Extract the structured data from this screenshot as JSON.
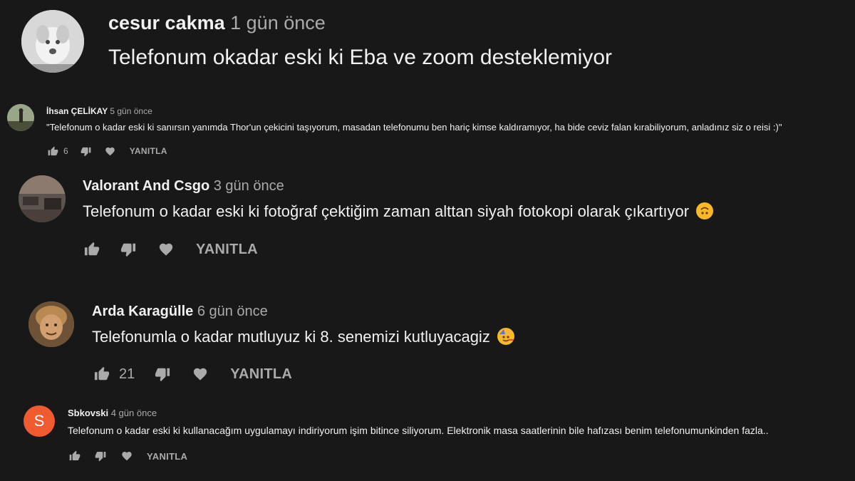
{
  "comments": [
    {
      "author": "cesur cakma",
      "time": "1 gün önce",
      "text": "Telefonum okadar eski ki Eba ve zoom desteklemiyor"
    },
    {
      "author": "İhsan ÇELİKAY",
      "time": "5 gün önce",
      "text": "\"Telefonum o kadar eski ki sanırsın yanımda Thor'un çekicini taşıyorum, masadan telefonumu ben hariç kimse kaldıramıyor, ha bide ceviz falan kırabiliyorum, anladınız siz o reisi :)\"",
      "likes": "6",
      "reply_label": "YANITLA"
    },
    {
      "author": "Valorant And Csgo",
      "time": "3 gün önce",
      "text": "Telefonum o kadar eski ki fotoğraf çektiğim zaman alttan siyah fotokopi olarak çıkartıyor",
      "emoji": "upside-down-face",
      "reply_label": "YANITLA"
    },
    {
      "author": "Arda Karagülle",
      "time": "6 gün önce",
      "text": "Telefonumla o kadar mutluyuz ki 8. senemizi kutluyacagiz",
      "emoji": "partying-face",
      "likes": "21",
      "reply_label": "YANITLA"
    },
    {
      "author": "Sbkovski",
      "time": "4 gün önce",
      "avatar_letter": "S",
      "avatar_color": "#ef5b2f",
      "text": "Telefonum o kadar eski ki kullanacağım uygulamayı indiriyorum işim bitince siliyorum. Elektronik masa saatlerinin bile hafızası benim telefonumunkinden fazla..",
      "reply_label": "YANITLA"
    }
  ],
  "colors": {
    "background": "#181818",
    "text": "#f1f1f1",
    "muted": "#aaaaaa",
    "emoji_yellow": "#f7b928"
  }
}
